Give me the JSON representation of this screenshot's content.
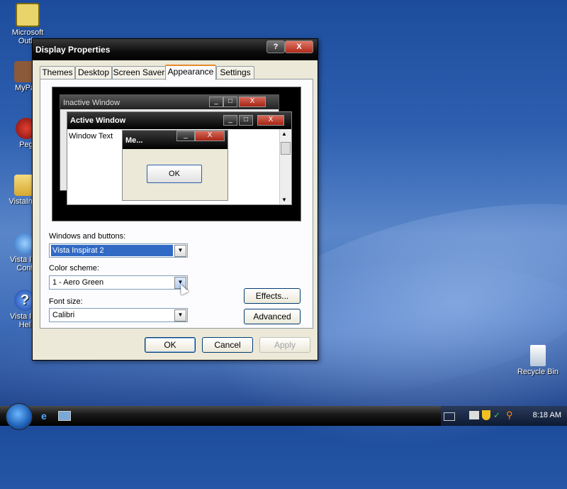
{
  "desktop": {
    "icons": [
      {
        "label": "Microsoft\nOutlo",
        "icon": "outlook-icon"
      },
      {
        "label": "MyPa",
        "icon": "my-pc-icon"
      },
      {
        "label": "Peg",
        "icon": "pegasus-icon"
      },
      {
        "label": "VistaInsp",
        "icon": "folder-icon"
      },
      {
        "label": "Vista Ins\nConf",
        "icon": "vista-config-icon"
      },
      {
        "label": "Vista Ins\nHel",
        "icon": "help-icon"
      },
      {
        "label": "Recycle Bin",
        "icon": "recycle-bin-icon"
      }
    ]
  },
  "dialog": {
    "title": "Display Properties",
    "help_button": "?",
    "close_button": "X",
    "tabs": [
      "Themes",
      "Desktop",
      "Screen Saver",
      "Appearance",
      "Settings"
    ],
    "active_tab": "Appearance",
    "preview": {
      "inactive_window": "Inactive Window",
      "active_window": "Active Window",
      "window_text": "Window Text",
      "message_box": "Me...",
      "ok": "OK"
    },
    "fields": {
      "windows_buttons_label": "Windows and buttons:",
      "windows_buttons_value": "Vista Inspirat 2",
      "color_scheme_label": "Color scheme:",
      "color_scheme_value": "1 - Aero Green",
      "font_size_label": "Font size:",
      "font_size_value": "Calibri"
    },
    "effects_button": "Effects...",
    "advanced_button": "Advanced",
    "ok_button": "OK",
    "cancel_button": "Cancel",
    "apply_button": "Apply"
  },
  "taskbar": {
    "clock": "8:18 AM"
  },
  "colors": {
    "accent": "#316ac5",
    "close_red": "#c43a2a",
    "tab_highlight": "#e68b2c"
  }
}
